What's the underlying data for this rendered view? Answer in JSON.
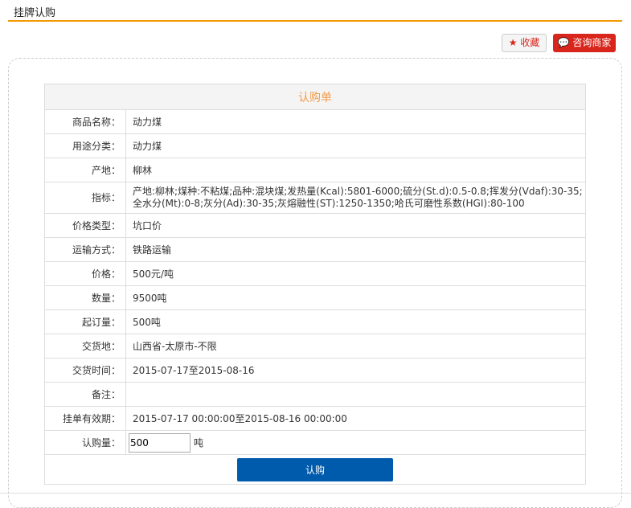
{
  "header": {
    "title": "挂牌认购"
  },
  "actions": {
    "favorite": "收藏",
    "consult": "咨询商家"
  },
  "form": {
    "title": "认购单",
    "rows": [
      {
        "label": "商品名称：",
        "value": "动力煤"
      },
      {
        "label": "用途分类：",
        "value": "动力煤"
      },
      {
        "label": "产地：",
        "value": "柳林"
      },
      {
        "label": "指标：",
        "value": "产地:柳林;煤种:不粘煤;品种:混块煤;发热量(Kcal):5801-6000;硫分(St.d):0.5-0.8;挥发分(Vdaf):30-35;全水分(Mt):0-8;灰分(Ad):30-35;灰熔融性(ST):1250-1350;哈氏可磨性系数(HGI):80-100"
      },
      {
        "label": "价格类型：",
        "value": "坑口价"
      },
      {
        "label": "运输方式：",
        "value": "铁路运输"
      },
      {
        "label": "价格：",
        "value": "500元/吨"
      },
      {
        "label": "数量：",
        "value": "9500吨"
      },
      {
        "label": "起订量：",
        "value": "500吨"
      },
      {
        "label": "交货地：",
        "value": "山西省-太原市-不限"
      },
      {
        "label": "交货时间：",
        "value": "2015-07-17至2015-08-16"
      },
      {
        "label": "备注：",
        "value": ""
      },
      {
        "label": "挂单有效期：",
        "value": "2015-07-17 00:00:00至2015-08-16 00:00:00"
      }
    ],
    "quantity": {
      "label": "认购量：",
      "value": "500",
      "unit": "吨"
    },
    "submit": "认购"
  }
}
